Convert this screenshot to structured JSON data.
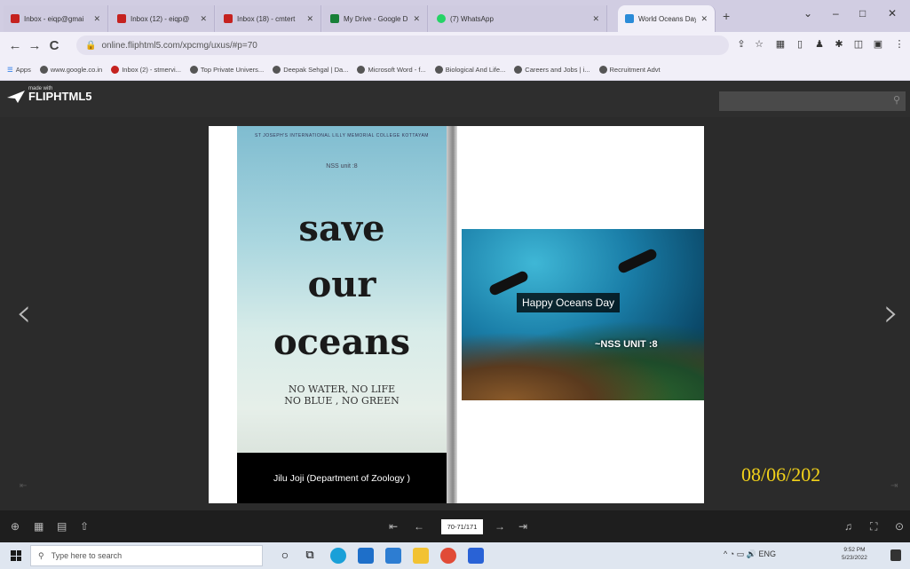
{
  "browser": {
    "tabs": [
      {
        "label": "Inbox - eiqp@gmai",
        "color": "#c5221f"
      },
      {
        "label": "Inbox (12) - eiqp@",
        "color": "#c5221f"
      },
      {
        "label": "Inbox (18) - cmtert",
        "color": "#c5221f"
      },
      {
        "label": "My Drive - Google D",
        "color": "#188038"
      },
      {
        "label": "(7) WhatsApp",
        "color": "#25d366"
      },
      {
        "label": "World Oceans Day",
        "color": "#2a8bd8",
        "active": true
      }
    ],
    "new_tab": "+",
    "window_controls": {
      "minimize": "–",
      "maximize": "□",
      "close": "✕"
    },
    "url": "online.fliphtml5.com/xpcmg/uxus/#p=70",
    "nav": {
      "back": "←",
      "forward": "→",
      "reload": "C"
    },
    "bookmarks": [
      "Apps",
      "www.google.co.in",
      "Inbox (2) - stmervi...",
      "Top Private Univers...",
      "Deepak Sehgal | Da...",
      "Microsoft Word - f...",
      "Biological And Life...",
      "Careers and Jobs | i...",
      "Recruitment Advt"
    ]
  },
  "fliphtml5": {
    "logo_small": "made with",
    "logo_text": "FLIPHTML5",
    "search_icon": "search-icon",
    "prev_arrow": "‹",
    "next_arrow": "›"
  },
  "left_page": {
    "college": "ST JOSEPH'S INTERNATIONAL LILLY MEMORIAL COLLEGE KOTTAYAM",
    "unit": "NSS unit :8",
    "line1": "save",
    "line2": "our",
    "line3": "oceans",
    "slogan1": "NO WATER, NO LIFE",
    "slogan2": "NO BLUE , NO GREEN",
    "caption": "Jilu Joji (Department of Zoology )"
  },
  "right_page": {
    "title": "Happy Oceans Day",
    "subtitle": "~NSS UNIT :8"
  },
  "overlay_date": "08/06/202",
  "toolbar": {
    "page_indicator": "70-71/171",
    "first": "⇤",
    "prev": "←",
    "next": "→",
    "last": "⇥"
  },
  "taskbar": {
    "search_placeholder": "Type here to search",
    "time": "9:52 PM",
    "date": "5/23/2022",
    "lang": "ENG"
  }
}
